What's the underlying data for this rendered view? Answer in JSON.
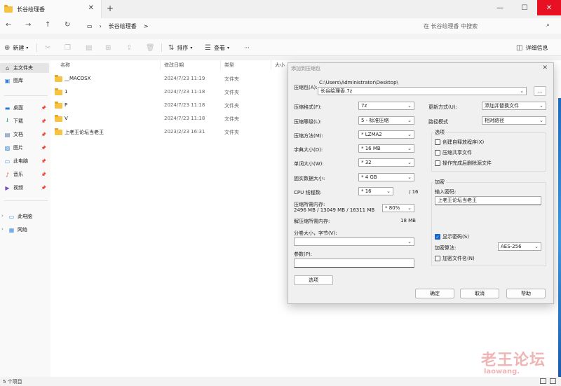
{
  "window": {
    "tab_title": "长谷绘理香",
    "new_tab": "+",
    "close_tab": "✕",
    "minimize": "—",
    "maximize": "☐",
    "close": "✕"
  },
  "nav": {
    "breadcrumb": [
      "长谷绘理香",
      ">"
    ],
    "search_placeholder": "在 长谷绘理香 中搜索"
  },
  "toolbar": {
    "new_label": "新建",
    "sort_label": "排序",
    "view_label": "查看",
    "more_label": "···",
    "details_label": "详细信息"
  },
  "sidebar": {
    "home": "主文件夹",
    "gallery": "图库",
    "quick": [
      {
        "label": "桌面",
        "icon": "desktop-icon",
        "color": "#2b7cd3"
      },
      {
        "label": "下载",
        "icon": "download-icon",
        "color": "#16a085"
      },
      {
        "label": "文档",
        "icon": "document-icon",
        "color": "#4a6fa5"
      },
      {
        "label": "图片",
        "icon": "picture-icon",
        "color": "#2b7cd3"
      },
      {
        "label": "此电脑",
        "icon": "computer-icon",
        "color": "#3a8ee6"
      },
      {
        "label": "音乐",
        "icon": "music-icon",
        "color": "#e0533a"
      },
      {
        "label": "视频",
        "icon": "video-icon",
        "color": "#7d4bc0"
      }
    ],
    "this_pc": "此电脑",
    "network": "网络"
  },
  "columns": {
    "name": "名称",
    "modified": "修改日期",
    "type": "类型",
    "size": "大小"
  },
  "files": [
    {
      "name": "__MACOSX",
      "date": "2024/7/23 11:19",
      "type": "文件夹"
    },
    {
      "name": "1",
      "date": "2024/7/23 11:18",
      "type": "文件夹"
    },
    {
      "name": "P",
      "date": "2024/7/23 11:18",
      "type": "文件夹"
    },
    {
      "name": "V",
      "date": "2024/7/23 11:18",
      "type": "文件夹"
    },
    {
      "name": "上老王论坛当老王",
      "date": "2023/2/23 16:31",
      "type": "文件夹"
    }
  ],
  "status": {
    "count": "5 个项目"
  },
  "watermark": {
    "main": "老王论坛",
    "sub": "laowang."
  },
  "dialog": {
    "title": "添加到压缩包",
    "archive_label": "压缩包(A):",
    "archive_path": "C:\\Users\\Administrator\\Desktop\\",
    "archive_name": "长谷绘理香.7z",
    "browse": "...",
    "format_label": "压缩格式(F):",
    "format_value": "7z",
    "level_label": "压缩等级(L):",
    "level_value": "5 - 标准压缩",
    "method_label": "压缩方法(M):",
    "method_value": "* LZMA2",
    "dict_label": "字典大小(D):",
    "dict_value": "* 16 MB",
    "word_label": "单词大小(W):",
    "word_value": "* 32",
    "solid_label": "固实数据大小:",
    "solid_value": "* 4 GB",
    "cpu_label": "CPU 线程数:",
    "cpu_value": "* 16",
    "cpu_total": "/ 16",
    "mem_label": "压缩所需内存:",
    "mem_detail": "2496 MB / 13049 MB / 16311 MB",
    "mem_value": "* 80%",
    "decomp_label": "解压缩所需内存:",
    "decomp_value": "18 MB",
    "split_label": "分卷大小，字节(V):",
    "params_label": "参数(P):",
    "options_button": "选项",
    "update_label": "更新方式(U):",
    "update_value": "添加并替换文件",
    "path_label": "路径模式",
    "path_value": "相对路径",
    "options_group": "选项",
    "opt_sfx": "创建自释放程序(X)",
    "opt_shared": "压缩共享文件",
    "opt_delete": "操作完成后删除源文件",
    "encrypt_group": "加密",
    "password_label": "输入密码:",
    "password_value": "上老王论坛当老王",
    "show_password": "显示密码(S)",
    "enc_method_label": "加密算法:",
    "enc_method_value": "AES-256",
    "enc_names": "加密文件名(N)",
    "ok": "确定",
    "cancel": "取消",
    "help": "帮助"
  }
}
